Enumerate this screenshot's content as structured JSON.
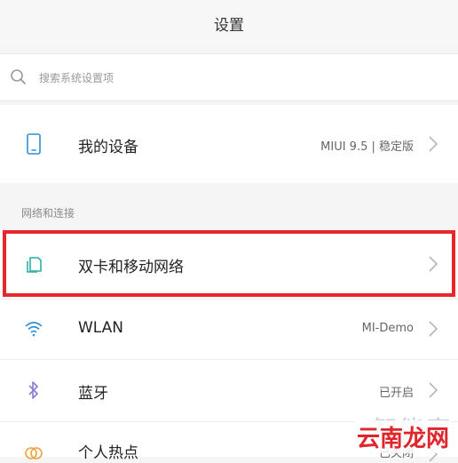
{
  "header": {
    "title": "设置"
  },
  "search": {
    "placeholder": "搜索系统设置项",
    "icon": "search-icon"
  },
  "device": {
    "label": "我的设备",
    "value": "MIUI 9.5 | 稳定版",
    "icon": "phone-icon"
  },
  "section": {
    "label": "网络和连接"
  },
  "items": [
    {
      "label": "双卡和移动网络",
      "value": "",
      "icon": "sim-cards-icon"
    },
    {
      "label": "WLAN",
      "value": "MI-Demo",
      "icon": "wifi-icon"
    },
    {
      "label": "蓝牙",
      "value": "已开启",
      "icon": "bluetooth-icon"
    },
    {
      "label": "个人热点",
      "value": "已关闭",
      "icon": "hotspot-icon"
    }
  ],
  "watermark": {
    "ghost": "智能家",
    "brand": "云南龙网"
  },
  "colors": {
    "highlight": "#e8262b",
    "icon_teal": "#2bb0a7",
    "icon_blue": "#2e8fd6",
    "icon_purple": "#8a7bd1",
    "icon_orange": "#f0a03c"
  }
}
